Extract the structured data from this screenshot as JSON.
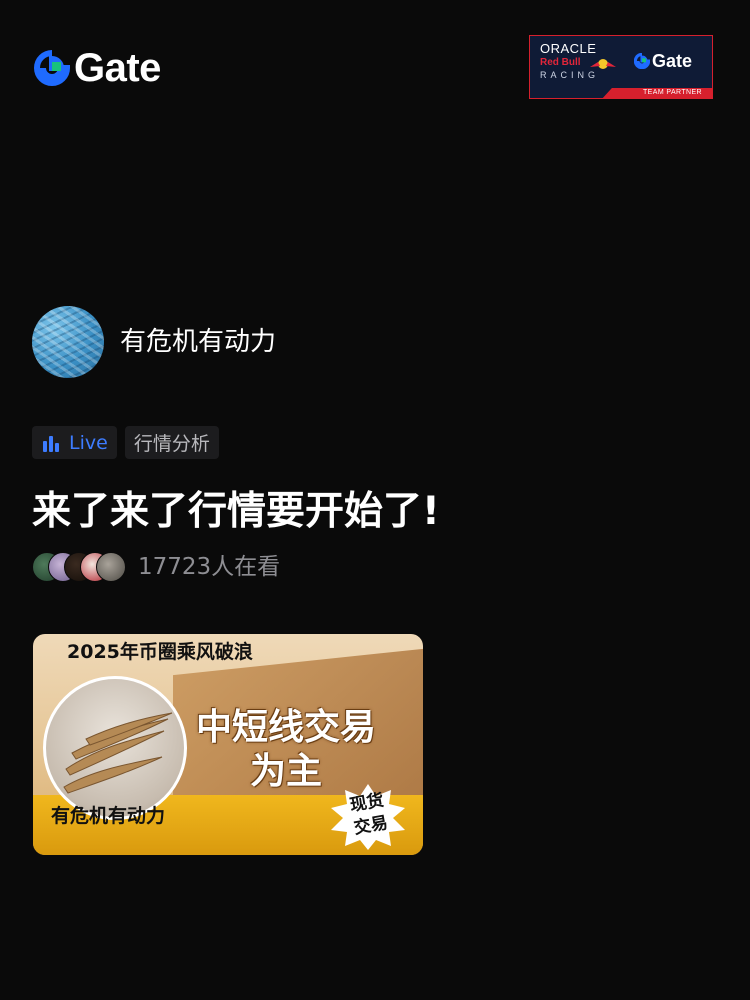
{
  "header": {
    "brand_name": "Gate",
    "brand_color": "#1f6bff",
    "partner_badge": {
      "line1": "ORACLE",
      "line2": "Red Bull",
      "line3": "RACING",
      "brand": "Gate",
      "strip_text": "TEAM PARTNER",
      "accent_color": "#d6202d",
      "bg_color": "#0f1b36"
    }
  },
  "host": {
    "name": "有危机有动力",
    "avatar_icon": "avatar-image"
  },
  "tags": {
    "live_label": "Live",
    "live_color": "#3d7cff",
    "topic_label": "行情分析"
  },
  "stream": {
    "title": "来了来了行情要开始了!",
    "viewer_count": "17723人在看"
  },
  "thumbnail": {
    "top_text": "2025年币圈乘风破浪",
    "host_label": "有危机有动力",
    "main_line1": "中短线交易",
    "main_line2": "为主",
    "burst_line1": "现货",
    "burst_line2": "交易"
  }
}
